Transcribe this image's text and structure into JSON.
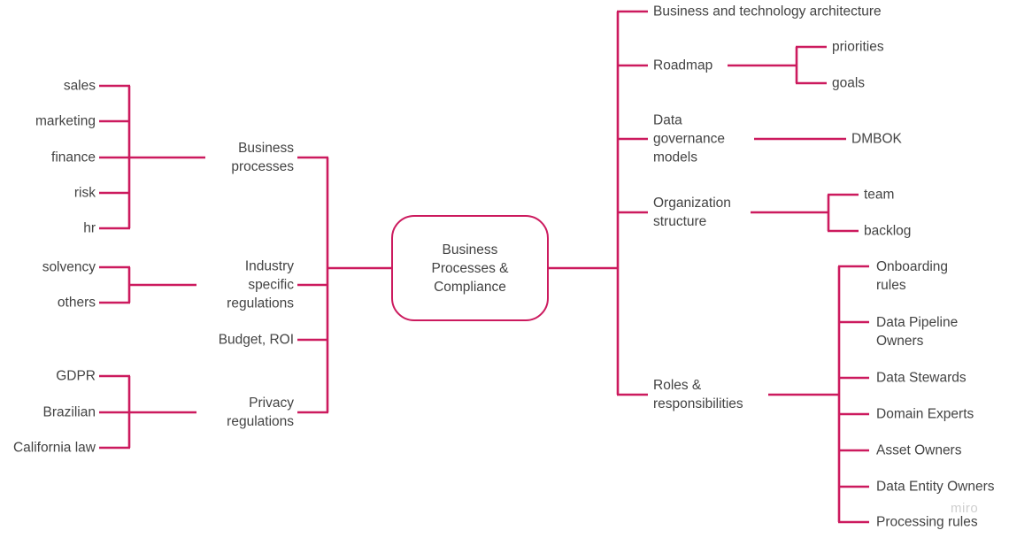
{
  "theme": {
    "line_color": "#CC1A5E",
    "text_color": "#434343",
    "background": "#ffffff",
    "watermark_color": "#cfcfcf"
  },
  "watermark": {
    "label": "miro"
  },
  "root": {
    "label": "Business\nProcesses &\nCompliance"
  },
  "left": {
    "branches": [
      {
        "label": "Business\nprocesses",
        "children": [
          {
            "label": "sales"
          },
          {
            "label": "marketing"
          },
          {
            "label": "finance"
          },
          {
            "label": "risk"
          },
          {
            "label": "hr"
          }
        ]
      },
      {
        "label": "Industry\nspecific\nregulations",
        "children": [
          {
            "label": "solvency"
          },
          {
            "label": "others"
          }
        ]
      },
      {
        "label": "Budget, ROI",
        "children": []
      },
      {
        "label": "Privacy\nregulations",
        "children": [
          {
            "label": "GDPR"
          },
          {
            "label": "Brazilian"
          },
          {
            "label": "California law"
          }
        ]
      }
    ]
  },
  "right": {
    "branches": [
      {
        "label": "Business and technology architecture",
        "children": []
      },
      {
        "label": "Roadmap",
        "children": [
          {
            "label": "priorities"
          },
          {
            "label": "goals"
          }
        ]
      },
      {
        "label": "Data\ngovernance\nmodels",
        "children": [
          {
            "label": "DMBOK"
          }
        ]
      },
      {
        "label": "Organization\nstructure",
        "children": [
          {
            "label": "team"
          },
          {
            "label": "backlog"
          }
        ]
      },
      {
        "label": "Roles &\nresponsibilities",
        "children": [
          {
            "label": "Onboarding\nrules"
          },
          {
            "label": "Data Pipeline\nOwners"
          },
          {
            "label": "Data Stewards"
          },
          {
            "label": "Domain Experts"
          },
          {
            "label": "Asset Owners"
          },
          {
            "label": "Data Entity Owners"
          },
          {
            "label": "Processing rules"
          }
        ]
      }
    ]
  }
}
